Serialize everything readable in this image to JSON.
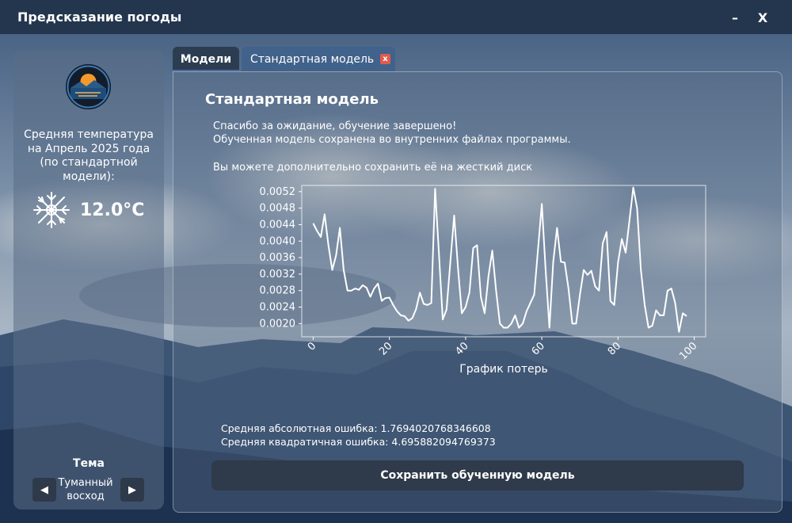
{
  "window": {
    "title": "Предсказание погоды",
    "minimize": "–",
    "close": "X"
  },
  "sidebar": {
    "avg_label": "Средняя температура на Апрель 2025 года (по стандартной модели):",
    "temperature": "12.0°C",
    "icon": "snowflake-sun-icon",
    "theme_label": "Тема",
    "theme_value": "Туманный восход",
    "prev": "◀",
    "next": "▶"
  },
  "tabs": [
    {
      "label": "Модели",
      "active": false
    },
    {
      "label": "Стандартная модель",
      "active": true,
      "close": "x"
    }
  ],
  "panel": {
    "title": "Стандартная модель",
    "message_line1": "Спасибо за ожидание, обучение завершено!",
    "message_line2": "Обученная модель сохранена во внутренних файлах программы.",
    "message_line3": "Вы можете дополнительно сохранить её на жесткий диск",
    "mae": "Средняя абсолютная ошибка: 1.7694020768346608",
    "mse": "Средняя квадратичная ошибка: 4.695882094769373",
    "save_button": "Сохранить обученную модель"
  },
  "colors": {
    "titlebar": "#24364e",
    "tab_active": "#41628a",
    "tab_close": "#e05a4f",
    "button": "#2f3a4a"
  },
  "chart_data": {
    "type": "line",
    "xlabel": "График потерь",
    "ylabel": "",
    "xlim": [
      -3,
      103
    ],
    "ylim": [
      0.00168,
      0.00535
    ],
    "xticks": [
      0,
      20,
      40,
      60,
      80,
      100
    ],
    "yticks": [
      "0.0020",
      "0.0024",
      "0.0028",
      "0.0032",
      "0.0036",
      "0.0040",
      "0.0044",
      "0.0048",
      "0.0052"
    ],
    "series": [
      {
        "values": [
          0.00443,
          0.00425,
          0.0041,
          0.00465,
          0.0039,
          0.0033,
          0.00365,
          0.00432,
          0.0033,
          0.0028,
          0.0028,
          0.00285,
          0.00282,
          0.00293,
          0.00287,
          0.00265,
          0.00285,
          0.00297,
          0.00255,
          0.00262,
          0.00263,
          0.00245,
          0.0023,
          0.0022,
          0.00218,
          0.00207,
          0.00213,
          0.00235,
          0.00275,
          0.00248,
          0.00245,
          0.0025,
          0.00527,
          0.0037,
          0.0021,
          0.00234,
          0.0035,
          0.00462,
          0.00335,
          0.00225,
          0.0024,
          0.00275,
          0.00383,
          0.0039,
          0.00265,
          0.00225,
          0.00315,
          0.00377,
          0.0028,
          0.002,
          0.0019,
          0.0019,
          0.002,
          0.0022,
          0.0019,
          0.002,
          0.0023,
          0.0025,
          0.0027,
          0.0038,
          0.0049,
          0.0033,
          0.0019,
          0.0035,
          0.00432,
          0.0035,
          0.00348,
          0.00285,
          0.002,
          0.002,
          0.0027,
          0.0033,
          0.00318,
          0.00328,
          0.0029,
          0.0028,
          0.00395,
          0.00422,
          0.00255,
          0.00245,
          0.00348,
          0.00405,
          0.00372,
          0.0045,
          0.0053,
          0.0048,
          0.0033,
          0.00245,
          0.0019,
          0.00195,
          0.00232,
          0.0022,
          0.0022,
          0.0028,
          0.00285,
          0.0025,
          0.0018,
          0.00225,
          0.00218
        ]
      }
    ]
  }
}
